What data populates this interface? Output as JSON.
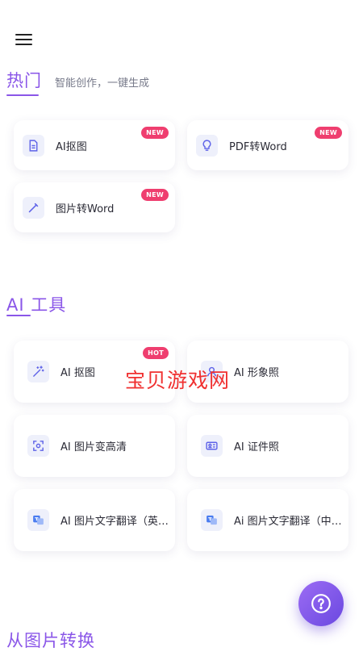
{
  "header": {
    "menu_icon": "hamburger-menu-icon"
  },
  "hot_section": {
    "title": "热门",
    "subtitle": "智能创作，一键生成",
    "accent_color": "#8a56e8",
    "items": [
      {
        "label": "AI抠图",
        "badge": "NEW",
        "icon": "document-icon"
      },
      {
        "label": "PDF转Word",
        "badge": "NEW",
        "icon": "lightbulb-icon"
      },
      {
        "label": "图片转Word",
        "badge": "NEW",
        "icon": "pen-icon"
      }
    ]
  },
  "ai_tools_section": {
    "title": "AI 工具",
    "items": [
      {
        "label": "AI 抠图",
        "badge": "HOT",
        "icon": "magic-wand-icon"
      },
      {
        "label": "AI 形象照",
        "icon": "portrait-icon"
      },
      {
        "label": "AI 图片变高清",
        "icon": "enhance-frame-icon"
      },
      {
        "label": "AI 证件照",
        "icon": "id-card-icon"
      },
      {
        "label": "AI 图片文字翻译（英…",
        "icon": "translate-icon"
      },
      {
        "label": "Ai 图片文字翻译（中…",
        "icon": "translate-icon"
      }
    ]
  },
  "convert_section": {
    "title": "从图片转换"
  },
  "watermark": "宝贝游戏网",
  "badge_color": "#ef3e6f",
  "fab": {
    "icon": "question-mark-icon"
  }
}
